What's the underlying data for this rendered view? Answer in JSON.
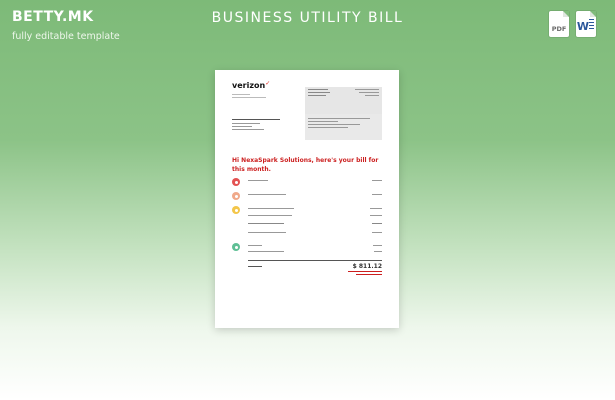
{
  "header": {
    "brand": "BETTY.MK",
    "tagline": "fully editable template",
    "title": "BUSINESS UTILITY BILL",
    "formats": [
      {
        "label": "PDF"
      },
      {
        "label": "W"
      }
    ]
  },
  "document": {
    "logo": "verizon",
    "greeting": "Hi NexaSpark Solutions, here's your bill for this month.",
    "total_amount": "$ 811.12"
  },
  "colors": {
    "background_top": "#7dba78",
    "background_bottom": "#ffffff",
    "accent_red": "#cc1f1f",
    "icon_red": "#e35252",
    "icon_orange": "#f0a98a",
    "icon_yellow": "#f3c64a",
    "icon_green": "#5fbf95"
  }
}
